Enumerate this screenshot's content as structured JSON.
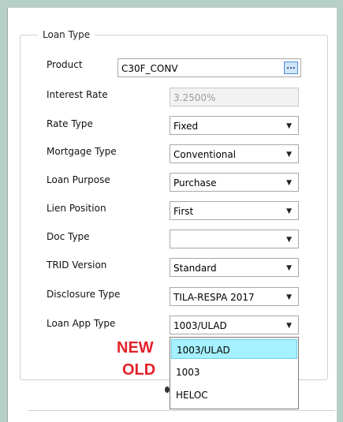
{
  "group": {
    "title": "Loan Type"
  },
  "product": {
    "label": "Product",
    "value": "C30F_CONV",
    "button": "..."
  },
  "interest_rate": {
    "label": "Interest Rate",
    "value": "3.2500%"
  },
  "rate_type": {
    "label": "Rate Type",
    "value": "Fixed"
  },
  "mortgage_type": {
    "label": "Mortgage Type",
    "value": "Conventional"
  },
  "loan_purpose": {
    "label": "Loan Purpose",
    "value": "Purchase"
  },
  "lien_position": {
    "label": "Lien Position",
    "value": "First"
  },
  "doc_type": {
    "label": "Doc Type",
    "value": ""
  },
  "trid_version": {
    "label": "TRID Version",
    "value": "Standard"
  },
  "disclosure_type": {
    "label": "Disclosure Type",
    "value": "TILA-RESPA 2017"
  },
  "loan_app_type": {
    "label": "Loan App Type",
    "value": "1003/ULAD",
    "options": [
      "1003/ULAD",
      "1003",
      "HELOC"
    ]
  },
  "annotations": {
    "new": "NEW",
    "old": "OLD"
  },
  "icons": {
    "dropdown_arrow": "▼"
  },
  "colors": {
    "selected_option": "#a5f1ff",
    "annotation": "#e3212a",
    "background": "#b6cfc7"
  }
}
